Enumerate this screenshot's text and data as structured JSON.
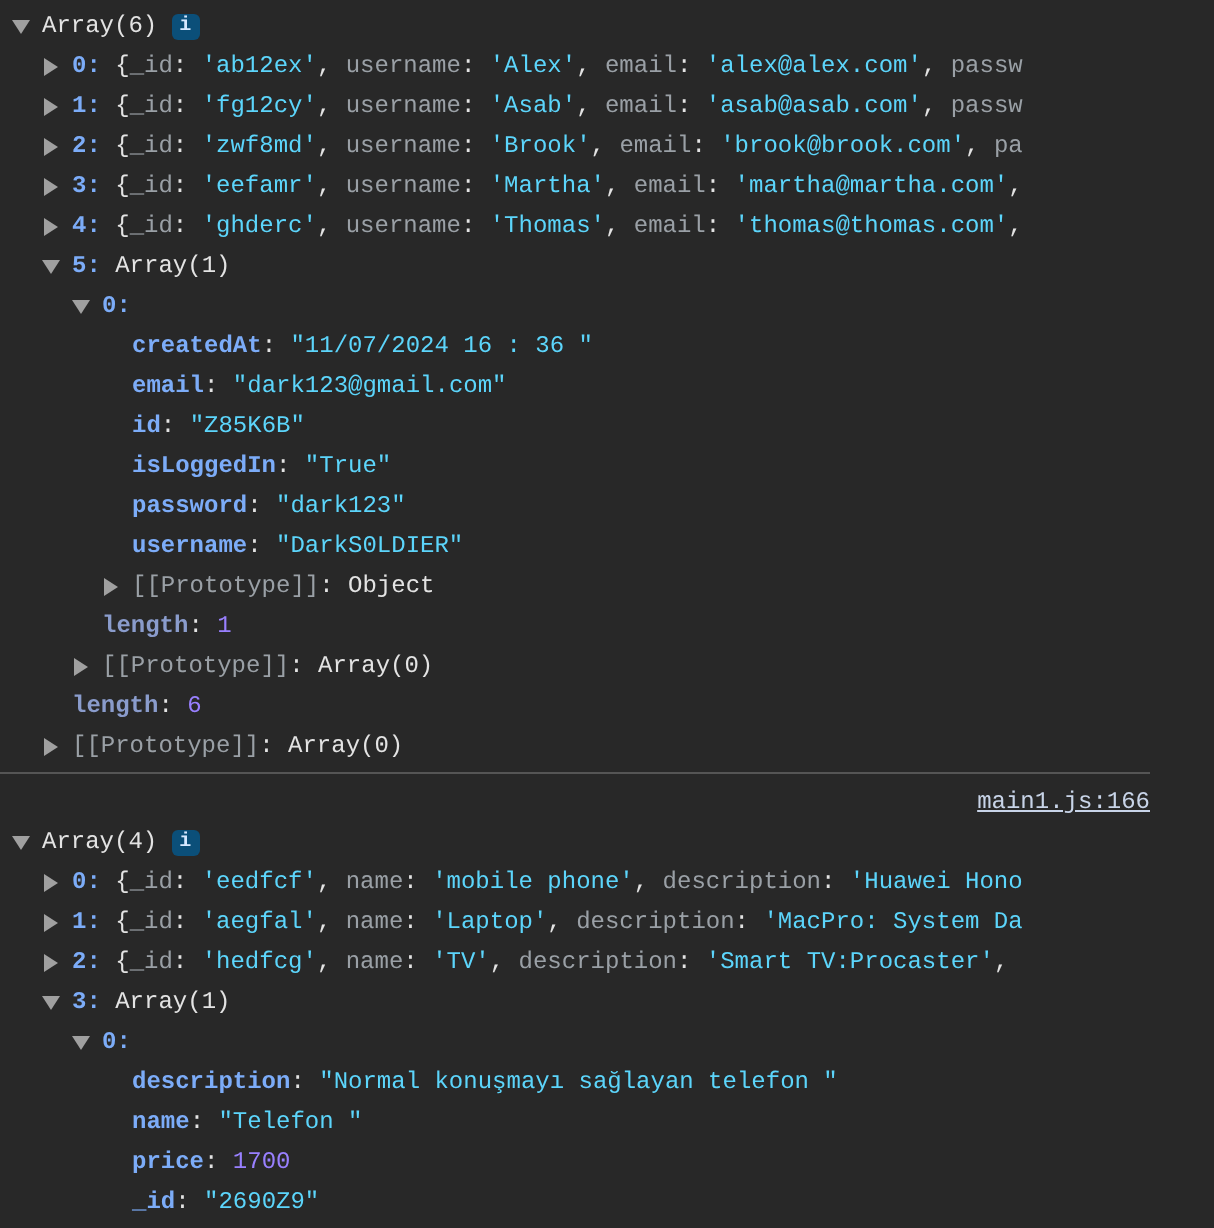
{
  "logs": [
    {
      "tree": [
        {
          "parts": [
            {
              "kind": "p",
              "t": "Array(6)"
            }
          ],
          "badge": "i",
          "expanded": true,
          "children": [
            {
              "parts": [
                {
                  "kind": "idx",
                  "t": "0:"
                },
                {
                  "kind": "p",
                  "t": " {"
                },
                {
                  "kind": "pkey",
                  "t": "_id"
                },
                {
                  "kind": "p",
                  "t": ": "
                },
                {
                  "kind": "str",
                  "t": "'ab12ex'"
                },
                {
                  "kind": "p",
                  "t": ", "
                },
                {
                  "kind": "pkey",
                  "t": "username"
                },
                {
                  "kind": "p",
                  "t": ": "
                },
                {
                  "kind": "str",
                  "t": "'Alex'"
                },
                {
                  "kind": "p",
                  "t": ", "
                },
                {
                  "kind": "pkey",
                  "t": "email"
                },
                {
                  "kind": "p",
                  "t": ": "
                },
                {
                  "kind": "str",
                  "t": "'alex@alex.com'"
                },
                {
                  "kind": "p",
                  "t": ", "
                },
                {
                  "kind": "pkey",
                  "t": "passw"
                }
              ],
              "expanded": false
            },
            {
              "parts": [
                {
                  "kind": "idx",
                  "t": "1:"
                },
                {
                  "kind": "p",
                  "t": " {"
                },
                {
                  "kind": "pkey",
                  "t": "_id"
                },
                {
                  "kind": "p",
                  "t": ": "
                },
                {
                  "kind": "str",
                  "t": "'fg12cy'"
                },
                {
                  "kind": "p",
                  "t": ", "
                },
                {
                  "kind": "pkey",
                  "t": "username"
                },
                {
                  "kind": "p",
                  "t": ": "
                },
                {
                  "kind": "str",
                  "t": "'Asab'"
                },
                {
                  "kind": "p",
                  "t": ", "
                },
                {
                  "kind": "pkey",
                  "t": "email"
                },
                {
                  "kind": "p",
                  "t": ": "
                },
                {
                  "kind": "str",
                  "t": "'asab@asab.com'"
                },
                {
                  "kind": "p",
                  "t": ", "
                },
                {
                  "kind": "pkey",
                  "t": "passw"
                }
              ],
              "expanded": false
            },
            {
              "parts": [
                {
                  "kind": "idx",
                  "t": "2:"
                },
                {
                  "kind": "p",
                  "t": " {"
                },
                {
                  "kind": "pkey",
                  "t": "_id"
                },
                {
                  "kind": "p",
                  "t": ": "
                },
                {
                  "kind": "str",
                  "t": "'zwf8md'"
                },
                {
                  "kind": "p",
                  "t": ", "
                },
                {
                  "kind": "pkey",
                  "t": "username"
                },
                {
                  "kind": "p",
                  "t": ": "
                },
                {
                  "kind": "str",
                  "t": "'Brook'"
                },
                {
                  "kind": "p",
                  "t": ", "
                },
                {
                  "kind": "pkey",
                  "t": "email"
                },
                {
                  "kind": "p",
                  "t": ": "
                },
                {
                  "kind": "str",
                  "t": "'brook@brook.com'"
                },
                {
                  "kind": "p",
                  "t": ", "
                },
                {
                  "kind": "pkey",
                  "t": "pa"
                }
              ],
              "expanded": false
            },
            {
              "parts": [
                {
                  "kind": "idx",
                  "t": "3:"
                },
                {
                  "kind": "p",
                  "t": " {"
                },
                {
                  "kind": "pkey",
                  "t": "_id"
                },
                {
                  "kind": "p",
                  "t": ": "
                },
                {
                  "kind": "str",
                  "t": "'eefamr'"
                },
                {
                  "kind": "p",
                  "t": ", "
                },
                {
                  "kind": "pkey",
                  "t": "username"
                },
                {
                  "kind": "p",
                  "t": ": "
                },
                {
                  "kind": "str",
                  "t": "'Martha'"
                },
                {
                  "kind": "p",
                  "t": ", "
                },
                {
                  "kind": "pkey",
                  "t": "email"
                },
                {
                  "kind": "p",
                  "t": ": "
                },
                {
                  "kind": "str",
                  "t": "'martha@martha.com'"
                },
                {
                  "kind": "p",
                  "t": ","
                }
              ],
              "expanded": false
            },
            {
              "parts": [
                {
                  "kind": "idx",
                  "t": "4:"
                },
                {
                  "kind": "p",
                  "t": " {"
                },
                {
                  "kind": "pkey",
                  "t": "_id"
                },
                {
                  "kind": "p",
                  "t": ": "
                },
                {
                  "kind": "str",
                  "t": "'ghderc'"
                },
                {
                  "kind": "p",
                  "t": ", "
                },
                {
                  "kind": "pkey",
                  "t": "username"
                },
                {
                  "kind": "p",
                  "t": ": "
                },
                {
                  "kind": "str",
                  "t": "'Thomas'"
                },
                {
                  "kind": "p",
                  "t": ", "
                },
                {
                  "kind": "pkey",
                  "t": "email"
                },
                {
                  "kind": "p",
                  "t": ": "
                },
                {
                  "kind": "str",
                  "t": "'thomas@thomas.com'"
                },
                {
                  "kind": "p",
                  "t": ","
                }
              ],
              "expanded": false
            },
            {
              "parts": [
                {
                  "kind": "idx",
                  "t": "5:"
                },
                {
                  "kind": "p",
                  "t": " Array(1)"
                }
              ],
              "expanded": true,
              "children": [
                {
                  "parts": [
                    {
                      "kind": "idx",
                      "t": "0:"
                    }
                  ],
                  "expanded": true,
                  "children": [
                    {
                      "parts": [
                        {
                          "kind": "key",
                          "t": "createdAt"
                        },
                        {
                          "kind": "p",
                          "t": ": "
                        },
                        {
                          "kind": "str",
                          "t": "\"11/07/2024 16 : 36 \""
                        }
                      ]
                    },
                    {
                      "parts": [
                        {
                          "kind": "key",
                          "t": "email"
                        },
                        {
                          "kind": "p",
                          "t": ": "
                        },
                        {
                          "kind": "str",
                          "t": "\"dark123@gmail.com\""
                        }
                      ]
                    },
                    {
                      "parts": [
                        {
                          "kind": "key",
                          "t": "id"
                        },
                        {
                          "kind": "p",
                          "t": ": "
                        },
                        {
                          "kind": "str",
                          "t": "\"Z85K6B\""
                        }
                      ]
                    },
                    {
                      "parts": [
                        {
                          "kind": "key",
                          "t": "isLoggedIn"
                        },
                        {
                          "kind": "p",
                          "t": ": "
                        },
                        {
                          "kind": "str",
                          "t": "\"True\""
                        }
                      ]
                    },
                    {
                      "parts": [
                        {
                          "kind": "key",
                          "t": "password"
                        },
                        {
                          "kind": "p",
                          "t": ": "
                        },
                        {
                          "kind": "str",
                          "t": "\"dark123\""
                        }
                      ]
                    },
                    {
                      "parts": [
                        {
                          "kind": "key",
                          "t": "username"
                        },
                        {
                          "kind": "p",
                          "t": ": "
                        },
                        {
                          "kind": "str",
                          "t": "\"DarkS0LDIER\""
                        }
                      ]
                    },
                    {
                      "parts": [
                        {
                          "kind": "proto",
                          "t": "[[Prototype]]"
                        },
                        {
                          "kind": "p",
                          "t": ": Object"
                        }
                      ],
                      "expanded": false
                    }
                  ]
                },
                {
                  "parts": [
                    {
                      "kind": "dkey",
                      "t": "length"
                    },
                    {
                      "kind": "p",
                      "t": ": "
                    },
                    {
                      "kind": "num",
                      "t": "1"
                    }
                  ]
                },
                {
                  "parts": [
                    {
                      "kind": "proto",
                      "t": "[[Prototype]]"
                    },
                    {
                      "kind": "p",
                      "t": ": Array(0)"
                    }
                  ],
                  "expanded": false
                }
              ]
            },
            {
              "parts": [
                {
                  "kind": "dkey",
                  "t": "length"
                },
                {
                  "kind": "p",
                  "t": ": "
                },
                {
                  "kind": "num",
                  "t": "6"
                }
              ]
            },
            {
              "parts": [
                {
                  "kind": "proto",
                  "t": "[[Prototype]]"
                },
                {
                  "kind": "p",
                  "t": ": Array(0)"
                }
              ],
              "expanded": false
            }
          ]
        }
      ]
    },
    {
      "source": "main1.js:166",
      "tree": [
        {
          "parts": [
            {
              "kind": "p",
              "t": "Array(4)"
            }
          ],
          "badge": "i",
          "expanded": true,
          "children": [
            {
              "parts": [
                {
                  "kind": "idx",
                  "t": "0:"
                },
                {
                  "kind": "p",
                  "t": " {"
                },
                {
                  "kind": "pkey",
                  "t": "_id"
                },
                {
                  "kind": "p",
                  "t": ": "
                },
                {
                  "kind": "str",
                  "t": "'eedfcf'"
                },
                {
                  "kind": "p",
                  "t": ", "
                },
                {
                  "kind": "pkey",
                  "t": "name"
                },
                {
                  "kind": "p",
                  "t": ": "
                },
                {
                  "kind": "str",
                  "t": "'mobile phone'"
                },
                {
                  "kind": "p",
                  "t": ", "
                },
                {
                  "kind": "pkey",
                  "t": "description"
                },
                {
                  "kind": "p",
                  "t": ": "
                },
                {
                  "kind": "str",
                  "t": "'Huawei Hono"
                }
              ],
              "expanded": false
            },
            {
              "parts": [
                {
                  "kind": "idx",
                  "t": "1:"
                },
                {
                  "kind": "p",
                  "t": " {"
                },
                {
                  "kind": "pkey",
                  "t": "_id"
                },
                {
                  "kind": "p",
                  "t": ": "
                },
                {
                  "kind": "str",
                  "t": "'aegfal'"
                },
                {
                  "kind": "p",
                  "t": ", "
                },
                {
                  "kind": "pkey",
                  "t": "name"
                },
                {
                  "kind": "p",
                  "t": ": "
                },
                {
                  "kind": "str",
                  "t": "'Laptop'"
                },
                {
                  "kind": "p",
                  "t": ", "
                },
                {
                  "kind": "pkey",
                  "t": "description"
                },
                {
                  "kind": "p",
                  "t": ": "
                },
                {
                  "kind": "str",
                  "t": "'MacPro: System Da"
                }
              ],
              "expanded": false
            },
            {
              "parts": [
                {
                  "kind": "idx",
                  "t": "2:"
                },
                {
                  "kind": "p",
                  "t": " {"
                },
                {
                  "kind": "pkey",
                  "t": "_id"
                },
                {
                  "kind": "p",
                  "t": ": "
                },
                {
                  "kind": "str",
                  "t": "'hedfcg'"
                },
                {
                  "kind": "p",
                  "t": ", "
                },
                {
                  "kind": "pkey",
                  "t": "name"
                },
                {
                  "kind": "p",
                  "t": ": "
                },
                {
                  "kind": "str",
                  "t": "'TV'"
                },
                {
                  "kind": "p",
                  "t": ", "
                },
                {
                  "kind": "pkey",
                  "t": "description"
                },
                {
                  "kind": "p",
                  "t": ": "
                },
                {
                  "kind": "str",
                  "t": "'Smart TV:Procaster'"
                },
                {
                  "kind": "p",
                  "t": ","
                }
              ],
              "expanded": false
            },
            {
              "parts": [
                {
                  "kind": "idx",
                  "t": "3:"
                },
                {
                  "kind": "p",
                  "t": " Array(1)"
                }
              ],
              "expanded": true,
              "children": [
                {
                  "parts": [
                    {
                      "kind": "idx",
                      "t": "0:"
                    }
                  ],
                  "expanded": true,
                  "children": [
                    {
                      "parts": [
                        {
                          "kind": "key",
                          "t": "description"
                        },
                        {
                          "kind": "p",
                          "t": ": "
                        },
                        {
                          "kind": "str",
                          "t": "\"Normal konuşmayı sağlayan telefon \""
                        }
                      ]
                    },
                    {
                      "parts": [
                        {
                          "kind": "key",
                          "t": "name"
                        },
                        {
                          "kind": "p",
                          "t": ": "
                        },
                        {
                          "kind": "str",
                          "t": "\"Telefon \""
                        }
                      ]
                    },
                    {
                      "parts": [
                        {
                          "kind": "key",
                          "t": "price"
                        },
                        {
                          "kind": "p",
                          "t": ": "
                        },
                        {
                          "kind": "num",
                          "t": "1700"
                        }
                      ]
                    },
                    {
                      "parts": [
                        {
                          "kind": "key",
                          "t": "_id"
                        },
                        {
                          "kind": "p",
                          "t": ": "
                        },
                        {
                          "kind": "str",
                          "t": "\"2690Z9\""
                        }
                      ]
                    }
                  ]
                }
              ]
            }
          ]
        }
      ]
    }
  ]
}
